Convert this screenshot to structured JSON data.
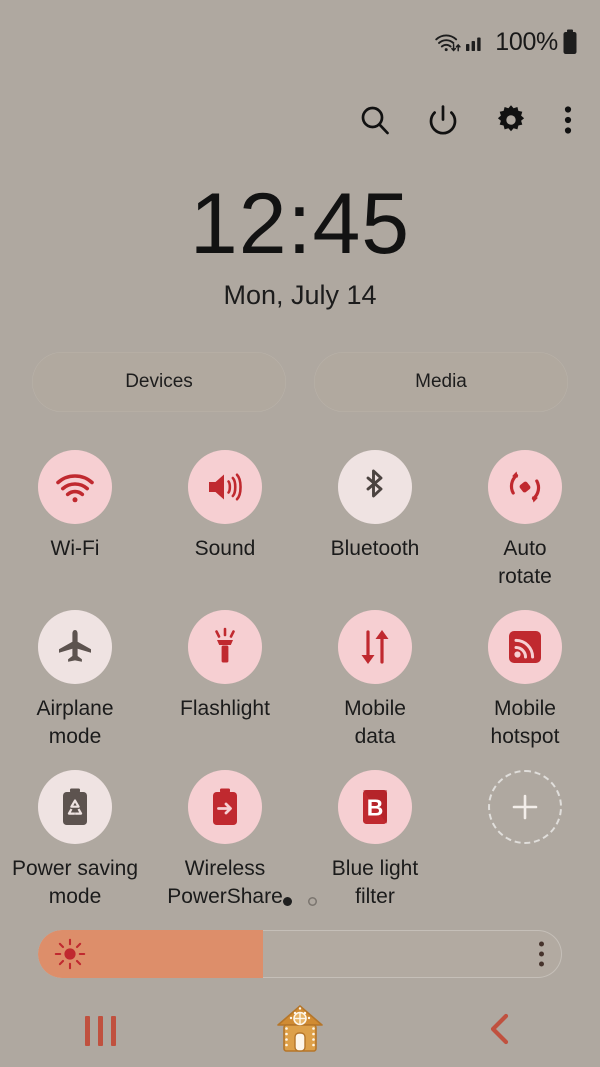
{
  "status_bar": {
    "wifi_icon": "wifi-transfer-icon",
    "signal_icon": "cellular-signal-icon",
    "battery_percent": "100%",
    "battery_icon": "battery-full-icon"
  },
  "header": {
    "buttons": [
      {
        "name": "search-button",
        "icon": "search-icon"
      },
      {
        "name": "power-button",
        "icon": "power-icon"
      },
      {
        "name": "settings-button",
        "icon": "gear-icon"
      },
      {
        "name": "more-options-button",
        "icon": "three-dots-vertical-icon"
      }
    ]
  },
  "clock": {
    "time": "12:45",
    "date": "Mon, July 14"
  },
  "pills": {
    "devices_label": "Devices",
    "media_label": "Media"
  },
  "toggles": [
    {
      "label": "Wi-Fi",
      "icon": "wifi-icon",
      "state": "on"
    },
    {
      "label": "Sound",
      "icon": "sound-icon",
      "state": "on"
    },
    {
      "label": "Bluetooth",
      "icon": "bluetooth-icon",
      "state": "off"
    },
    {
      "label": "Auto\nrotate",
      "icon": "auto-rotate-icon",
      "state": "on"
    },
    {
      "label": "Airplane\nmode",
      "icon": "airplane-icon",
      "state": "off"
    },
    {
      "label": "Flashlight",
      "icon": "flashlight-icon",
      "state": "on"
    },
    {
      "label": "Mobile\ndata",
      "icon": "mobile-data-icon",
      "state": "on"
    },
    {
      "label": "Mobile\nhotspot",
      "icon": "hotspot-icon",
      "state": "on"
    },
    {
      "label": "Power saving\nmode",
      "icon": "power-saving-icon",
      "state": "off"
    },
    {
      "label": "Wireless\nPowerShare",
      "icon": "powershare-icon",
      "state": "on"
    },
    {
      "label": "Blue light\nfilter",
      "icon": "blue-light-filter-icon",
      "state": "on"
    },
    {
      "label": "",
      "icon": "add-icon",
      "state": "add"
    }
  ],
  "page_indicator": {
    "total": 2,
    "active_index": 0
  },
  "brightness": {
    "value_percent": 43,
    "sun_icon": "brightness-sun-icon",
    "menu_icon": "three-dots-vertical-icon"
  },
  "nav_bar": {
    "recents_label": "recents-icon",
    "home_label": "gingerbread-house-home-icon",
    "back_label": "back-chevron-icon"
  },
  "colors": {
    "background": "#afa8a0",
    "accent_on_bg": "#f6cfd2",
    "accent_icon": "#c0292f",
    "off_bg": "#efe3e2",
    "off_icon": "#5d534f",
    "slider_fill": "#dd8e6a",
    "nav_accent": "#c0513f"
  }
}
